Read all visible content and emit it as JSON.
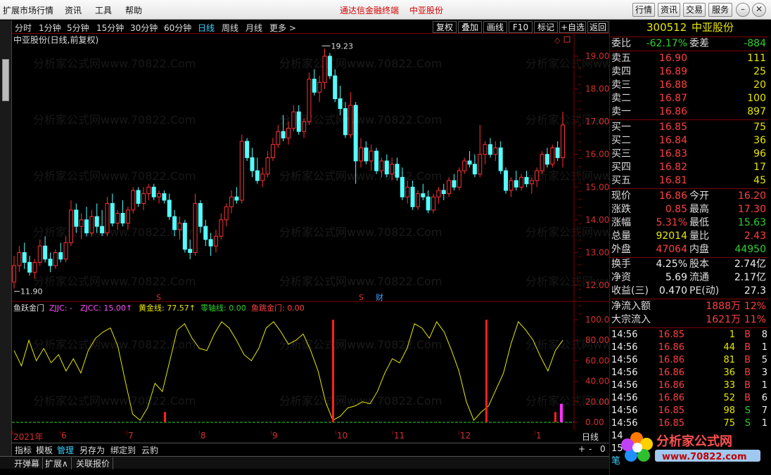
{
  "menu": {
    "items": [
      "扩展市场行情",
      "资讯",
      "工具",
      "帮助"
    ],
    "center_a": "通达信金融终端",
    "center_b": "中亚股份",
    "buttons": [
      "行情",
      "资讯",
      "交易",
      "服务"
    ]
  },
  "periods": {
    "items": [
      "分时",
      "1分钟",
      "5分钟",
      "15分钟",
      "30分钟",
      "60分钟",
      "日线",
      "周线",
      "月线",
      "更多 >"
    ],
    "active_index": 6
  },
  "toolbar": {
    "items": [
      "复权",
      "叠加",
      "画线",
      "F10",
      "标记",
      "+自选",
      "返回"
    ]
  },
  "chart": {
    "title": "中亚股份(日线,前复权)",
    "price_ticks": [
      "19.00",
      "18.00",
      "17.00",
      "16.00",
      "15.00",
      "14.00",
      "13.00",
      "12.00"
    ],
    "high_label": "19.23",
    "low_label": "11.90",
    "marker_s": "S",
    "marker_cai": "财"
  },
  "indicator": {
    "name": "鱼跃金门",
    "zjjc": "ZJJC: -",
    "zjcc": "ZJCC: 15.00↑",
    "gold": "黄金线: 77.57↑",
    "zero": "零轴线: 0.00",
    "yjm": "鱼跳金门: 0.00",
    "ticks": [
      "100.00",
      "80.00",
      "60.00",
      "40.00",
      "20.00",
      "0.00"
    ]
  },
  "xaxis": {
    "labels": [
      "2021年",
      "6",
      "7",
      "8",
      "9",
      "10",
      "11",
      "12",
      "1"
    ],
    "period": "日线",
    "ctrl": [
      "+",
      "-",
      "0"
    ]
  },
  "indtabs": {
    "items": [
      "指标",
      "模板",
      "管理",
      "另存为",
      "绑定到",
      "云豹"
    ],
    "active_index": 2
  },
  "statusbar": {
    "items": [
      "开弹幕",
      "扩展∧",
      "关联报价"
    ]
  },
  "quote": {
    "code": "300512",
    "name": "中亚股份",
    "weibi_label": "委比",
    "weibi": "-62.17%",
    "weicha_label": "委差",
    "weicha": "-884",
    "asks": [
      {
        "label": "卖五",
        "price": "16.90",
        "vol": "111"
      },
      {
        "label": "卖四",
        "price": "16.89",
        "vol": "25"
      },
      {
        "label": "卖三",
        "price": "16.88",
        "vol": "20"
      },
      {
        "label": "卖二",
        "price": "16.87",
        "vol": "100"
      },
      {
        "label": "卖一",
        "price": "16.86",
        "vol": "897"
      }
    ],
    "bids": [
      {
        "label": "买一",
        "price": "16.85",
        "vol": "75"
      },
      {
        "label": "买二",
        "price": "16.84",
        "vol": "36"
      },
      {
        "label": "买三",
        "price": "16.83",
        "vol": "96"
      },
      {
        "label": "买四",
        "price": "16.82",
        "vol": "17"
      },
      {
        "label": "买五",
        "price": "16.81",
        "vol": "45"
      }
    ],
    "stats": [
      {
        "l1": "现价",
        "v1": "16.86",
        "c1": "red",
        "l2": "今开",
        "v2": "16.20",
        "c2": "red"
      },
      {
        "l1": "涨跌",
        "v1": "0.85",
        "c1": "red",
        "l2": "最高",
        "v2": "17.30",
        "c2": "red"
      },
      {
        "l1": "涨幅",
        "v1": "5.31%",
        "c1": "red",
        "l2": "最低",
        "v2": "15.63",
        "c2": "green"
      },
      {
        "l1": "总量",
        "v1": "92014",
        "c1": "yellow",
        "l2": "量比",
        "v2": "2.43",
        "c2": "red"
      },
      {
        "l1": "外盘",
        "v1": "47064",
        "c1": "red",
        "l2": "内盘",
        "v2": "44950",
        "c2": "green"
      }
    ],
    "fin": [
      {
        "l1": "换手",
        "v1": "4.25%",
        "l2": "股本",
        "v2": "2.74亿"
      },
      {
        "l1": "净资",
        "v1": "5.69",
        "l2": "流通",
        "v2": "2.17亿"
      },
      {
        "l1": "收益(三)",
        "v1": "0.470",
        "l2": "PE(动)",
        "v2": "27.3"
      }
    ],
    "flows": [
      {
        "label": "净流入额",
        "amt": "1888万",
        "pct": "12%"
      },
      {
        "label": "大宗流入",
        "amt": "1621万",
        "pct": "11%"
      }
    ],
    "ticks": [
      {
        "t": "14:56",
        "p": "16.85",
        "v": "1",
        "d": "B",
        "n": "8"
      },
      {
        "t": "14:56",
        "p": "16.86",
        "v": "44",
        "d": "B",
        "n": "1"
      },
      {
        "t": "14:56",
        "p": "16.86",
        "v": "81",
        "d": "B",
        "n": "5"
      },
      {
        "t": "14:56",
        "p": "16.86",
        "v": "36",
        "d": "B",
        "n": "3"
      },
      {
        "t": "14:56",
        "p": "16.86",
        "v": "33",
        "d": "B",
        "n": "1"
      },
      {
        "t": "14:56",
        "p": "16.86",
        "v": "52",
        "d": "B",
        "n": "6"
      },
      {
        "t": "14:56",
        "p": "16.85",
        "v": "98",
        "d": "S",
        "n": "7"
      },
      {
        "t": "14:56",
        "p": "16.85",
        "v": "75",
        "d": "S",
        "n": "1"
      }
    ],
    "tail_rows": [
      "14",
      "15",
      "笔"
    ]
  },
  "watermark": "分析家公式网www.70822.Com",
  "logo": {
    "text": "分析家公式网",
    "url": "www.70822.com"
  },
  "candles": [
    [
      12.1,
      12.9,
      11.9,
      12.6
    ],
    [
      12.6,
      13.2,
      12.4,
      13.0
    ],
    [
      13.0,
      13.3,
      12.5,
      12.7
    ],
    [
      12.7,
      12.9,
      12.3,
      12.4
    ],
    [
      12.4,
      12.8,
      12.2,
      12.7
    ],
    [
      12.7,
      13.4,
      12.6,
      13.2
    ],
    [
      13.2,
      13.5,
      12.7,
      12.8
    ],
    [
      12.8,
      13.0,
      12.4,
      12.6
    ],
    [
      12.6,
      13.1,
      12.5,
      13.0
    ],
    [
      13.0,
      13.3,
      12.7,
      12.8
    ],
    [
      12.8,
      13.5,
      12.7,
      13.3
    ],
    [
      13.3,
      14.6,
      13.2,
      14.3
    ],
    [
      14.3,
      14.5,
      13.6,
      13.8
    ],
    [
      13.8,
      14.2,
      13.4,
      14.0
    ],
    [
      14.0,
      14.4,
      13.5,
      13.6
    ],
    [
      13.6,
      14.3,
      13.5,
      14.1
    ],
    [
      14.1,
      14.5,
      13.6,
      13.8
    ],
    [
      13.8,
      14.3,
      13.5,
      13.6
    ],
    [
      13.6,
      14.7,
      13.5,
      14.5
    ],
    [
      14.5,
      14.8,
      13.8,
      13.9
    ],
    [
      13.9,
      14.3,
      13.7,
      14.2
    ],
    [
      14.2,
      14.6,
      13.8,
      13.9
    ],
    [
      13.9,
      14.4,
      13.7,
      14.3
    ],
    [
      14.3,
      15.0,
      14.2,
      14.9
    ],
    [
      14.9,
      15.0,
      14.4,
      14.5
    ],
    [
      14.5,
      15.0,
      14.3,
      14.8
    ],
    [
      14.8,
      15.1,
      14.6,
      15.0
    ],
    [
      15.0,
      15.1,
      14.6,
      14.7
    ],
    [
      14.7,
      14.9,
      14.5,
      14.8
    ],
    [
      14.8,
      14.9,
      14.5,
      14.6
    ],
    [
      14.6,
      14.8,
      14.0,
      14.1
    ],
    [
      14.1,
      14.3,
      13.5,
      13.7
    ],
    [
      13.7,
      14.1,
      13.4,
      13.9
    ],
    [
      13.9,
      14.0,
      13.0,
      13.1
    ],
    [
      13.1,
      13.4,
      12.8,
      13.0
    ],
    [
      13.0,
      14.8,
      12.9,
      14.5
    ],
    [
      14.5,
      14.6,
      13.6,
      13.8
    ],
    [
      13.8,
      14.0,
      13.2,
      13.4
    ],
    [
      13.4,
      13.6,
      12.9,
      13.2
    ],
    [
      13.2,
      13.7,
      13.0,
      13.5
    ],
    [
      13.5,
      14.2,
      13.4,
      14.0
    ],
    [
      14.0,
      14.5,
      13.8,
      14.4
    ],
    [
      14.4,
      14.9,
      14.2,
      14.7
    ],
    [
      14.7,
      15.0,
      14.5,
      14.6
    ],
    [
      14.6,
      16.6,
      14.5,
      16.4
    ],
    [
      16.4,
      16.5,
      15.8,
      15.9
    ],
    [
      15.9,
      16.2,
      15.3,
      15.5
    ],
    [
      15.5,
      15.9,
      15.1,
      15.2
    ],
    [
      15.2,
      15.6,
      15.0,
      15.4
    ],
    [
      15.4,
      16.1,
      15.3,
      15.9
    ],
    [
      15.9,
      16.5,
      15.8,
      16.3
    ],
    [
      16.3,
      16.9,
      16.2,
      16.7
    ],
    [
      16.7,
      17.2,
      16.4,
      16.5
    ],
    [
      16.5,
      17.0,
      16.3,
      16.8
    ],
    [
      16.8,
      17.5,
      16.7,
      17.3
    ],
    [
      17.3,
      17.5,
      16.6,
      16.7
    ],
    [
      16.7,
      17.1,
      16.5,
      17.0
    ],
    [
      17.0,
      18.5,
      16.9,
      18.3
    ],
    [
      18.3,
      18.6,
      17.8,
      17.9
    ],
    [
      17.9,
      18.4,
      17.6,
      18.2
    ],
    [
      18.2,
      19.23,
      18.0,
      19.0
    ],
    [
      19.0,
      19.1,
      18.3,
      18.4
    ],
    [
      18.4,
      18.6,
      17.6,
      17.7
    ],
    [
      17.7,
      18.1,
      17.2,
      17.4
    ],
    [
      17.4,
      17.6,
      16.5,
      16.6
    ],
    [
      16.6,
      17.9,
      16.5,
      17.5
    ],
    [
      17.5,
      17.6,
      15.1,
      15.8
    ],
    [
      15.8,
      16.5,
      15.6,
      16.2
    ],
    [
      16.2,
      16.4,
      15.7,
      15.8
    ],
    [
      15.8,
      16.3,
      15.5,
      16.1
    ],
    [
      16.1,
      16.2,
      15.4,
      15.5
    ],
    [
      15.5,
      15.9,
      15.3,
      15.8
    ],
    [
      15.8,
      16.0,
      15.3,
      15.4
    ],
    [
      15.4,
      15.9,
      15.2,
      15.7
    ],
    [
      15.7,
      15.9,
      15.2,
      15.3
    ],
    [
      15.3,
      15.6,
      14.6,
      14.7
    ],
    [
      14.7,
      15.2,
      14.5,
      15.0
    ],
    [
      15.0,
      15.2,
      14.3,
      14.4
    ],
    [
      14.4,
      14.9,
      14.3,
      14.8
    ],
    [
      14.8,
      15.1,
      14.6,
      14.7
    ],
    [
      14.7,
      14.9,
      14.2,
      14.3
    ],
    [
      14.3,
      14.8,
      14.2,
      14.7
    ],
    [
      14.7,
      15.0,
      14.5,
      14.9
    ],
    [
      14.9,
      15.1,
      14.6,
      14.8
    ],
    [
      14.8,
      15.3,
      14.7,
      15.2
    ],
    [
      15.2,
      15.4,
      14.9,
      15.0
    ],
    [
      15.0,
      15.6,
      14.9,
      15.5
    ],
    [
      15.5,
      15.9,
      15.4,
      15.8
    ],
    [
      15.8,
      16.1,
      15.6,
      15.7
    ],
    [
      15.7,
      16.0,
      15.3,
      15.4
    ],
    [
      15.4,
      16.9,
      15.3,
      16.0
    ],
    [
      16.0,
      16.4,
      15.7,
      16.3
    ],
    [
      16.3,
      16.5,
      15.9,
      16.0
    ],
    [
      16.0,
      16.4,
      15.8,
      16.2
    ],
    [
      16.2,
      16.4,
      15.4,
      15.5
    ],
    [
      15.5,
      15.6,
      14.8,
      14.9
    ],
    [
      14.9,
      15.3,
      14.7,
      15.2
    ],
    [
      15.2,
      15.5,
      14.9,
      15.0
    ],
    [
      15.0,
      15.4,
      14.9,
      15.3
    ],
    [
      15.3,
      15.5,
      15.0,
      15.1
    ],
    [
      15.1,
      15.3,
      14.8,
      15.2
    ],
    [
      15.2,
      15.6,
      15.0,
      15.5
    ],
    [
      15.5,
      16.1,
      15.4,
      16.0
    ],
    [
      16.0,
      16.2,
      15.6,
      15.7
    ],
    [
      15.7,
      16.3,
      15.6,
      16.2
    ],
    [
      16.2,
      16.4,
      15.8,
      15.9
    ],
    [
      15.9,
      17.3,
      15.6,
      16.9
    ]
  ]
}
